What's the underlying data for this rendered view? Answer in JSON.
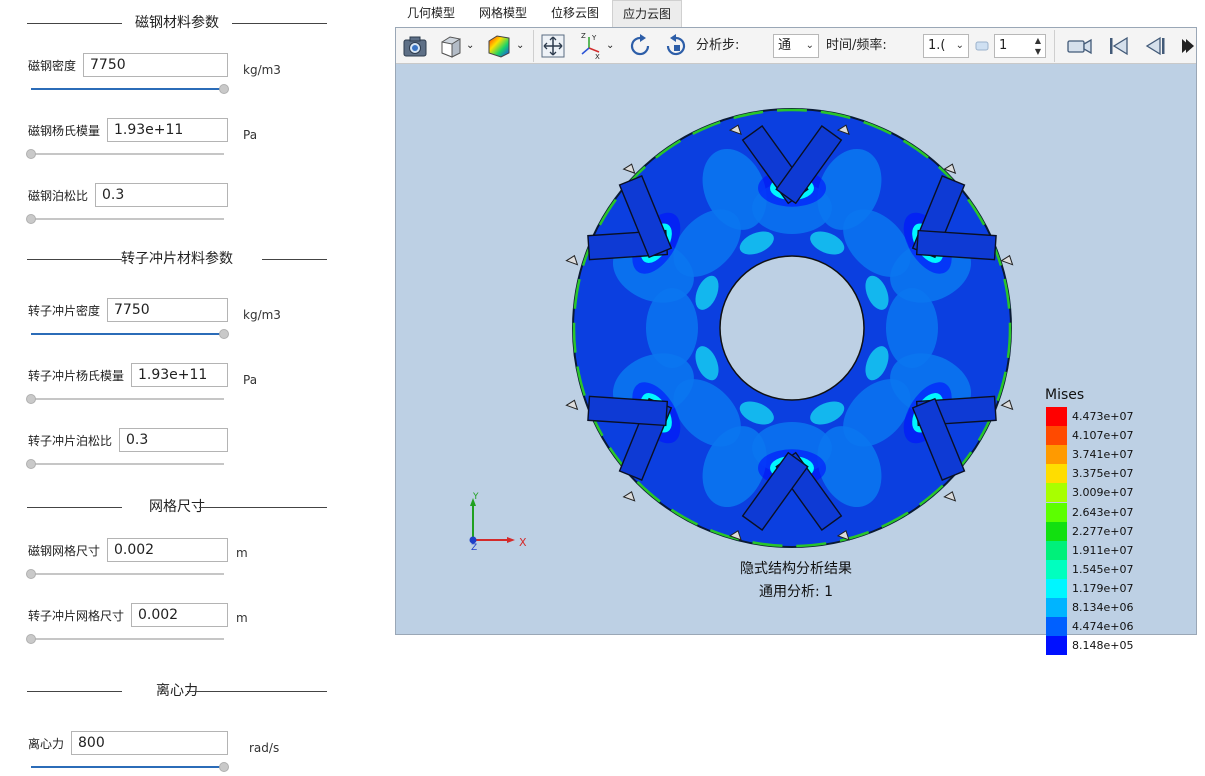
{
  "sections": {
    "magnet_material": "磁钢材料参数",
    "rotor_material": "转子冲片材料参数",
    "mesh_size": "网格尺寸",
    "centrifugal": "离心力"
  },
  "params": {
    "magnet_density": {
      "label": "磁钢密度",
      "value": "7750",
      "unit": "kg/m3",
      "slider": 1.0
    },
    "magnet_youngs": {
      "label": "磁钢杨氏模量",
      "value": "1.93e+11",
      "unit": "Pa",
      "slider": 0.0
    },
    "magnet_poisson": {
      "label": "磁钢泊松比",
      "value": "0.3",
      "unit": "",
      "slider": 0.0
    },
    "rotor_density": {
      "label": "转子冲片密度",
      "value": "7750",
      "unit": "kg/m3",
      "slider": 1.0
    },
    "rotor_youngs": {
      "label": "转子冲片杨氏模量",
      "value": "1.93e+11",
      "unit": "Pa",
      "slider": 0.0
    },
    "rotor_poisson": {
      "label": "转子冲片泊松比",
      "value": "0.3",
      "unit": "",
      "slider": 0.0
    },
    "magnet_mesh": {
      "label": "磁钢网格尺寸",
      "value": "0.002",
      "unit": "m",
      "slider": 0.0
    },
    "rotor_mesh": {
      "label": "转子冲片网格尺寸",
      "value": "0.002",
      "unit": "m",
      "slider": 0.0
    },
    "centrifugal_speed": {
      "label": "离心力",
      "value": "800",
      "unit": "rad/s",
      "slider": 1.0
    }
  },
  "tabs": [
    {
      "label": "几何模型",
      "active": false
    },
    {
      "label": "网格模型",
      "active": false
    },
    {
      "label": "位移云图",
      "active": false
    },
    {
      "label": "应力云图",
      "active": true
    }
  ],
  "toolbar": {
    "analysis_step_label": "分析步:",
    "analysis_step_value": "通",
    "time_freq_label": "时间/频率:",
    "time_freq_value": "1.(",
    "frame_value": "1"
  },
  "viewer": {
    "caption_line1": "隐式结构分析结果",
    "caption_line2": "通用分析: 1",
    "axis_x": "X",
    "axis_y": "Y",
    "axis_z": "Z",
    "legend_title": "Mises",
    "legend": [
      {
        "value": "4.473e+07",
        "color": "#ff0000"
      },
      {
        "value": "4.107e+07",
        "color": "#ff4a00"
      },
      {
        "value": "3.741e+07",
        "color": "#ff9a00"
      },
      {
        "value": "3.375e+07",
        "color": "#ffdd00"
      },
      {
        "value": "3.009e+07",
        "color": "#a8ff00"
      },
      {
        "value": "2.643e+07",
        "color": "#5cff00"
      },
      {
        "value": "2.277e+07",
        "color": "#12e010"
      },
      {
        "value": "1.911e+07",
        "color": "#00f07a"
      },
      {
        "value": "1.545e+07",
        "color": "#00ffbf"
      },
      {
        "value": "1.179e+07",
        "color": "#00f6ff"
      },
      {
        "value": "8.134e+06",
        "color": "#00b4ff"
      },
      {
        "value": "4.474e+06",
        "color": "#0060ff"
      },
      {
        "value": "8.148e+05",
        "color": "#0010ff"
      }
    ],
    "colors": {
      "background": "#bdd0e4",
      "base_stress": "#0b3fe0",
      "low_stress": "#0a75f0",
      "mid_stress": "#14c4f0"
    }
  }
}
